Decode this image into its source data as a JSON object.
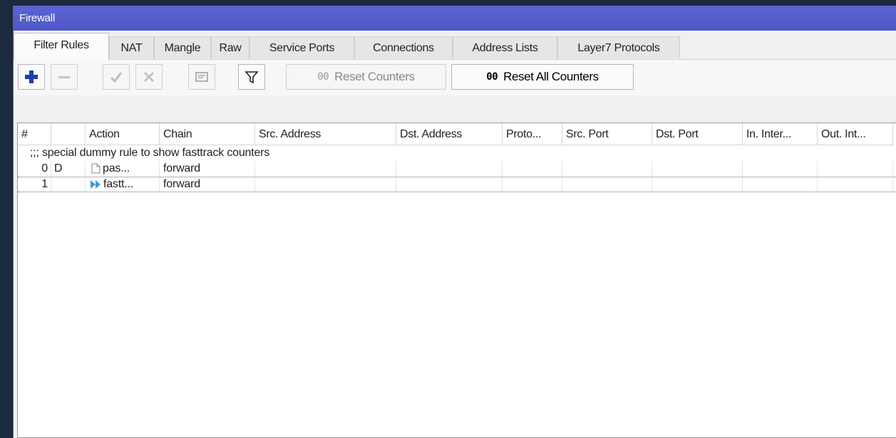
{
  "window": {
    "title": "Firewall"
  },
  "tabs": [
    {
      "label": "Filter Rules",
      "active": true
    },
    {
      "label": "NAT",
      "active": false
    },
    {
      "label": "Mangle",
      "active": false
    },
    {
      "label": "Raw",
      "active": false
    },
    {
      "label": "Service Ports",
      "active": false
    },
    {
      "label": "Connections",
      "active": false
    },
    {
      "label": "Address Lists",
      "active": false
    },
    {
      "label": "Layer7 Protocols",
      "active": false
    }
  ],
  "toolbar": {
    "add_icon": "plus-icon",
    "remove_icon": "minus-icon",
    "enable_icon": "check-icon",
    "disable_icon": "cross-icon",
    "comment_icon": "note-icon",
    "filter_icon": "funnel-icon",
    "reset_counters_prefix": "00",
    "reset_counters_label": "Reset Counters",
    "reset_all_counters_prefix": "00",
    "reset_all_counters_label": "Reset All Counters",
    "accent_color": "#1e3fa8"
  },
  "table": {
    "columns": [
      "#",
      "",
      "Action",
      "Chain",
      "Src. Address",
      "Dst. Address",
      "Proto...",
      "Src. Port",
      "Dst. Port",
      "In. Inter...",
      "Out. Int..."
    ],
    "comment": ";;; special dummy rule to show fasttrack counters",
    "rows": [
      {
        "num": "0",
        "flag": "D",
        "action_icon": "passthrough-icon",
        "action": "pas...",
        "chain": "forward"
      },
      {
        "num": "1",
        "flag": "",
        "action_icon": "fasttrack-icon",
        "action": "fastt...",
        "chain": "forward"
      }
    ]
  }
}
